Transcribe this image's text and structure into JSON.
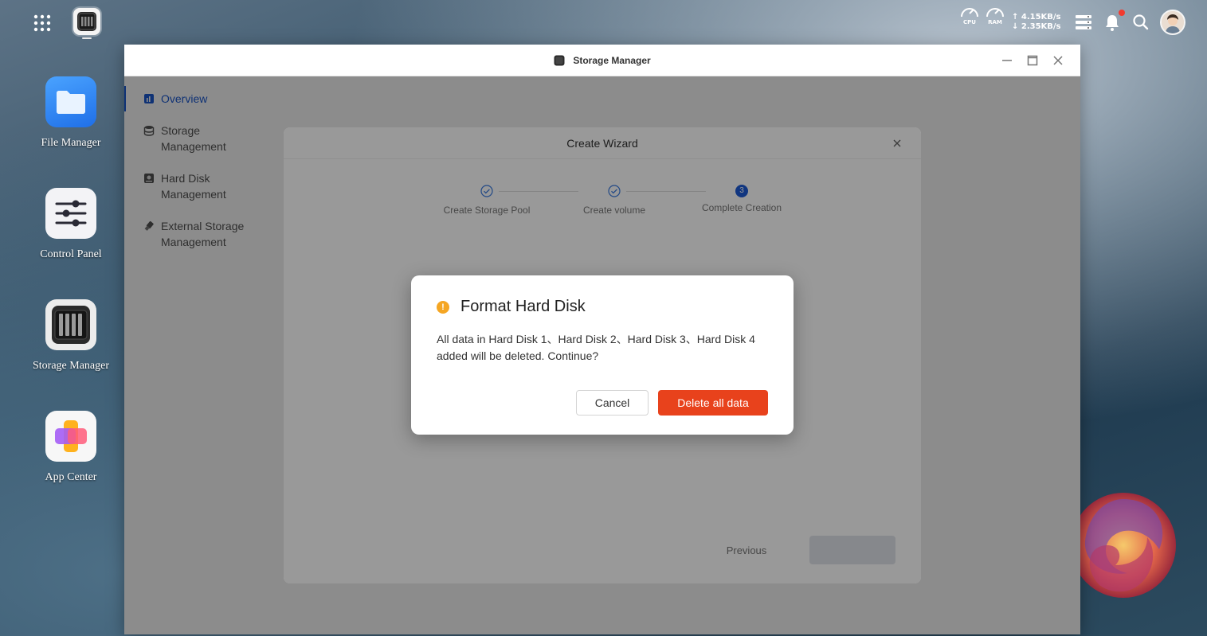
{
  "taskbar": {
    "cpu_label": "CPU",
    "ram_label": "RAM",
    "upload_speed": "↑ 4.15KB/s",
    "download_speed": "↓ 2.35KB/s"
  },
  "desktop": {
    "icons": [
      {
        "label": "File Manager"
      },
      {
        "label": "Control Panel"
      },
      {
        "label": "Storage Manager"
      },
      {
        "label": "App Center"
      }
    ]
  },
  "window": {
    "title": "Storage Manager",
    "sidebar": [
      {
        "label": "Overview",
        "active": true
      },
      {
        "label": "Storage Management"
      },
      {
        "label": "Hard Disk Management"
      },
      {
        "label": "External Storage Management"
      }
    ]
  },
  "wizard": {
    "title": "Create Wizard",
    "steps": [
      {
        "label": "Create Storage Pool"
      },
      {
        "label": "Create volume"
      },
      {
        "label": "Complete Creation",
        "number": "3"
      }
    ],
    "previous_label": "Previous"
  },
  "dialog": {
    "title": "Format Hard Disk",
    "message": "All data in Hard Disk 1、Hard Disk 2、Hard Disk 3、Hard Disk 4 added will be deleted. Continue?",
    "cancel_label": "Cancel",
    "confirm_label": "Delete all data"
  },
  "colors": {
    "accent": "#1d5bd6",
    "danger": "#e8421c",
    "warning": "#f5a623"
  }
}
